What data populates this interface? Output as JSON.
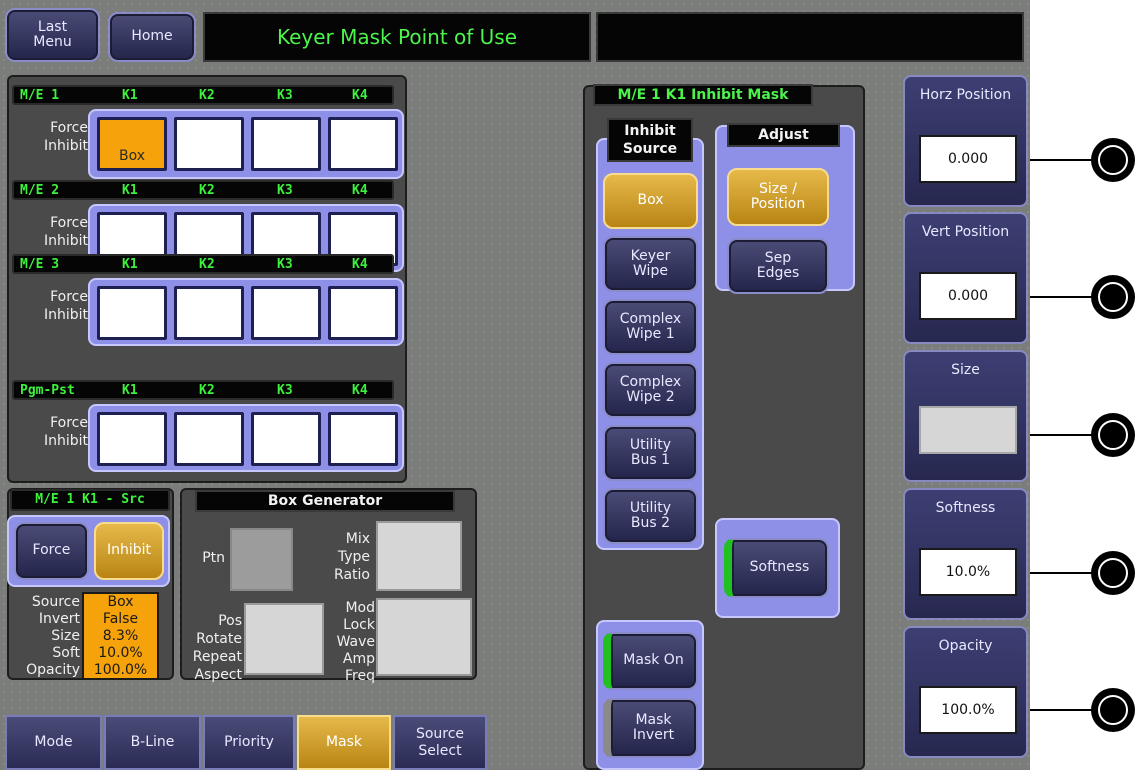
{
  "topbar": {
    "last_menu": "Last\nMenu",
    "home": "Home",
    "title": "Keyer Mask Point of Use",
    "status": ""
  },
  "me_groups": [
    {
      "name": "M/E 1",
      "keys": [
        "K1",
        "K2",
        "K3",
        "K4"
      ],
      "row_label": "Force\nInhibit",
      "cells": [
        "Box",
        "",
        "",
        ""
      ]
    },
    {
      "name": "M/E 2",
      "keys": [
        "K1",
        "K2",
        "K3",
        "K4"
      ],
      "row_label": "Force\nInhibit",
      "cells": [
        "",
        "",
        "",
        ""
      ]
    },
    {
      "name": "M/E 3",
      "keys": [
        "K1",
        "K2",
        "K3",
        "K4"
      ],
      "row_label": "Force\nInhibit",
      "cells": [
        "",
        "",
        "",
        ""
      ]
    },
    {
      "name": "Pgm-Pst",
      "keys": [
        "K1",
        "K2",
        "K3",
        "K4"
      ],
      "row_label": "Force\nInhibit",
      "cells": [
        "",
        "",
        "",
        ""
      ]
    }
  ],
  "src_panel": {
    "title": "M/E 1 K1 - Src",
    "force": "Force",
    "inhibit": "Inhibit",
    "labels": [
      "Source",
      "Invert",
      "Size",
      "Soft",
      "Opacity"
    ],
    "values": [
      "Box",
      "False",
      "8.3%",
      "10.0%",
      "100.0%"
    ]
  },
  "box_generator": {
    "title": "Box Generator",
    "ptn": "Ptn",
    "mix": [
      "Mix",
      "Type",
      "Ratio"
    ],
    "pos": [
      "Pos",
      "Rotate",
      "Repeat",
      "Aspect"
    ],
    "mod": [
      "Mod",
      "Lock",
      "Wave",
      "Amp",
      "Freq"
    ]
  },
  "inhibit_mask": {
    "title": "M/E 1 K1 Inhibit Mask",
    "source_title": "Inhibit\nSource",
    "sources": [
      "Box",
      "Keyer\nWipe",
      "Complex\nWipe 1",
      "Complex\nWipe 2",
      "Utility\nBus 1",
      "Utility\nBus 2"
    ],
    "adjust_title": "Adjust",
    "adjust": [
      "Size /\nPosition",
      "Sep\nEdges"
    ],
    "softness": "Softness",
    "mask_on": "Mask On",
    "mask_invert": "Mask\nInvert"
  },
  "right_panels": [
    {
      "title": "Horz Position",
      "value": "0.000"
    },
    {
      "title": "Vert Position",
      "value": "0.000"
    },
    {
      "title": "Size",
      "value": ""
    },
    {
      "title": "Softness",
      "value": "10.0%"
    },
    {
      "title": "Opacity",
      "value": "100.0%"
    }
  ],
  "tabs": [
    "Mode",
    "B-Line",
    "Priority",
    "Mask",
    "Source\nSelect"
  ],
  "active_tab": "Mask",
  "colors": {
    "accent_gold": "#e6b94a",
    "header_green": "#3df23d",
    "frame_purple": "#8e8fe6",
    "cell_orange": "#f6a20a"
  }
}
